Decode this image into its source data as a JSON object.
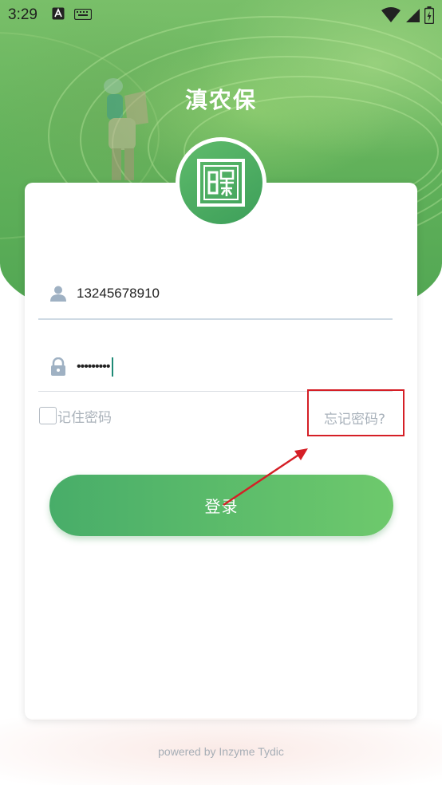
{
  "status_bar": {
    "time": "3:29"
  },
  "app": {
    "title": "滇农保"
  },
  "login_form": {
    "phone_value": "13245678910",
    "password_mask": "•••••••••",
    "remember_label": "记住密码",
    "forgot_label": "忘记密码?",
    "login_label": "登录"
  },
  "footer": {
    "text": "powered by Inzyme Tydic"
  },
  "colors": {
    "brand_green": "#4fae68",
    "annotation_red": "#d51f26",
    "cursor_teal": "#1e8a76"
  },
  "icons": {
    "user": "user-icon",
    "lock": "lock-icon",
    "logo": "app-logo"
  }
}
